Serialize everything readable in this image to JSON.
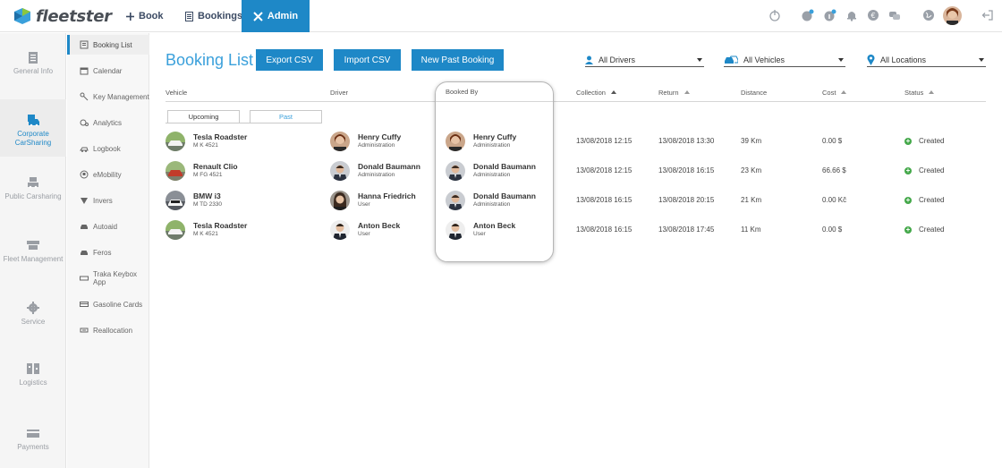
{
  "app": {
    "brand": "fleetster"
  },
  "topnav": {
    "book": "Book",
    "bookings": "Bookings",
    "admin": "Admin"
  },
  "topicons": [
    "power-icon",
    "notification-alert-icon",
    "info-alert-icon",
    "bell-icon",
    "euro-icon",
    "chat-icon",
    "globe-icon",
    "user-avatar",
    "logout-icon"
  ],
  "rail": [
    {
      "label": "General Info",
      "icon": "clipboard-icon",
      "active": false
    },
    {
      "label": "Corporate CarSharing",
      "icon": "corporate-car-icon",
      "active": true
    },
    {
      "label": "Public Carsharing",
      "icon": "public-car-icon",
      "active": false
    },
    {
      "label": "Fleet Management",
      "icon": "fleet-icon",
      "active": false
    },
    {
      "label": "Service",
      "icon": "gear-icon",
      "active": false
    },
    {
      "label": "Logistics",
      "icon": "logistics-icon",
      "active": false
    },
    {
      "label": "Payments",
      "icon": "credit-card-icon",
      "active": false
    }
  ],
  "submenu": [
    {
      "label": "Booking List",
      "active": true
    },
    {
      "label": "Calendar"
    },
    {
      "label": "Key Management"
    },
    {
      "label": "Analytics"
    },
    {
      "label": "Logbook"
    },
    {
      "label": "eMobility"
    },
    {
      "label": "Invers"
    },
    {
      "label": "Autoaid"
    },
    {
      "label": "Feros"
    },
    {
      "label": "Traka Keybox App"
    },
    {
      "label": "Gasoline Cards"
    },
    {
      "label": "Reallocation"
    }
  ],
  "main": {
    "title": "Booking List",
    "buttons": {
      "export": "Export CSV",
      "import": "Import CSV",
      "new_past": "New Past Booking"
    },
    "filters": {
      "drivers": "All Drivers",
      "vehicles": "All Vehicles",
      "locations": "All Locations"
    },
    "columns": {
      "vehicle": "Vehicle",
      "driver": "Driver",
      "booked_by": "Booked By",
      "collection": "Collection",
      "return": "Return",
      "distance": "Distance",
      "cost": "Cost",
      "status": "Status"
    },
    "tabs": {
      "upcoming": "Upcoming",
      "past": "Past"
    },
    "rows": [
      {
        "vehicle": "Tesla Roadster",
        "plate": "M K 4521",
        "driver": "Henry Cuffy",
        "driver_role": "Administration",
        "booked_by": "Henry Cuffy",
        "booked_role": "Administration",
        "collection": "13/08/2018 12:15",
        "return": "13/08/2018 13:30",
        "distance": "39 Km",
        "cost": "0.00 $",
        "status": "Created"
      },
      {
        "vehicle": "Renault Clio",
        "plate": "M FG 4521",
        "driver": "Donald Baumann",
        "driver_role": "Administration",
        "booked_by": "Donald Baumann",
        "booked_role": "Administration",
        "collection": "13/08/2018 12:15",
        "return": "13/08/2018 16:15",
        "distance": "23 Km",
        "cost": "66.66 $",
        "status": "Created"
      },
      {
        "vehicle": "BMW i3",
        "plate": "M TD 2330",
        "driver": "Hanna Friedrich",
        "driver_role": "User",
        "booked_by": "Donald Baumann",
        "booked_role": "Administration",
        "collection": "13/08/2018 16:15",
        "return": "13/08/2018 20:15",
        "distance": "21 Km",
        "cost": "0.00 Kč",
        "status": "Created"
      },
      {
        "vehicle": "Tesla Roadster",
        "plate": "M K 4521",
        "driver": "Anton Beck",
        "driver_role": "User",
        "booked_by": "Anton Beck",
        "booked_role": "User",
        "collection": "13/08/2018 16:15",
        "return": "13/08/2018 17:45",
        "distance": "11 Km",
        "cost": "0.00 $",
        "status": "Created"
      }
    ]
  },
  "colors": {
    "accent": "#1e88c7",
    "title": "#3aa0db",
    "status_ok": "#44a84a"
  }
}
